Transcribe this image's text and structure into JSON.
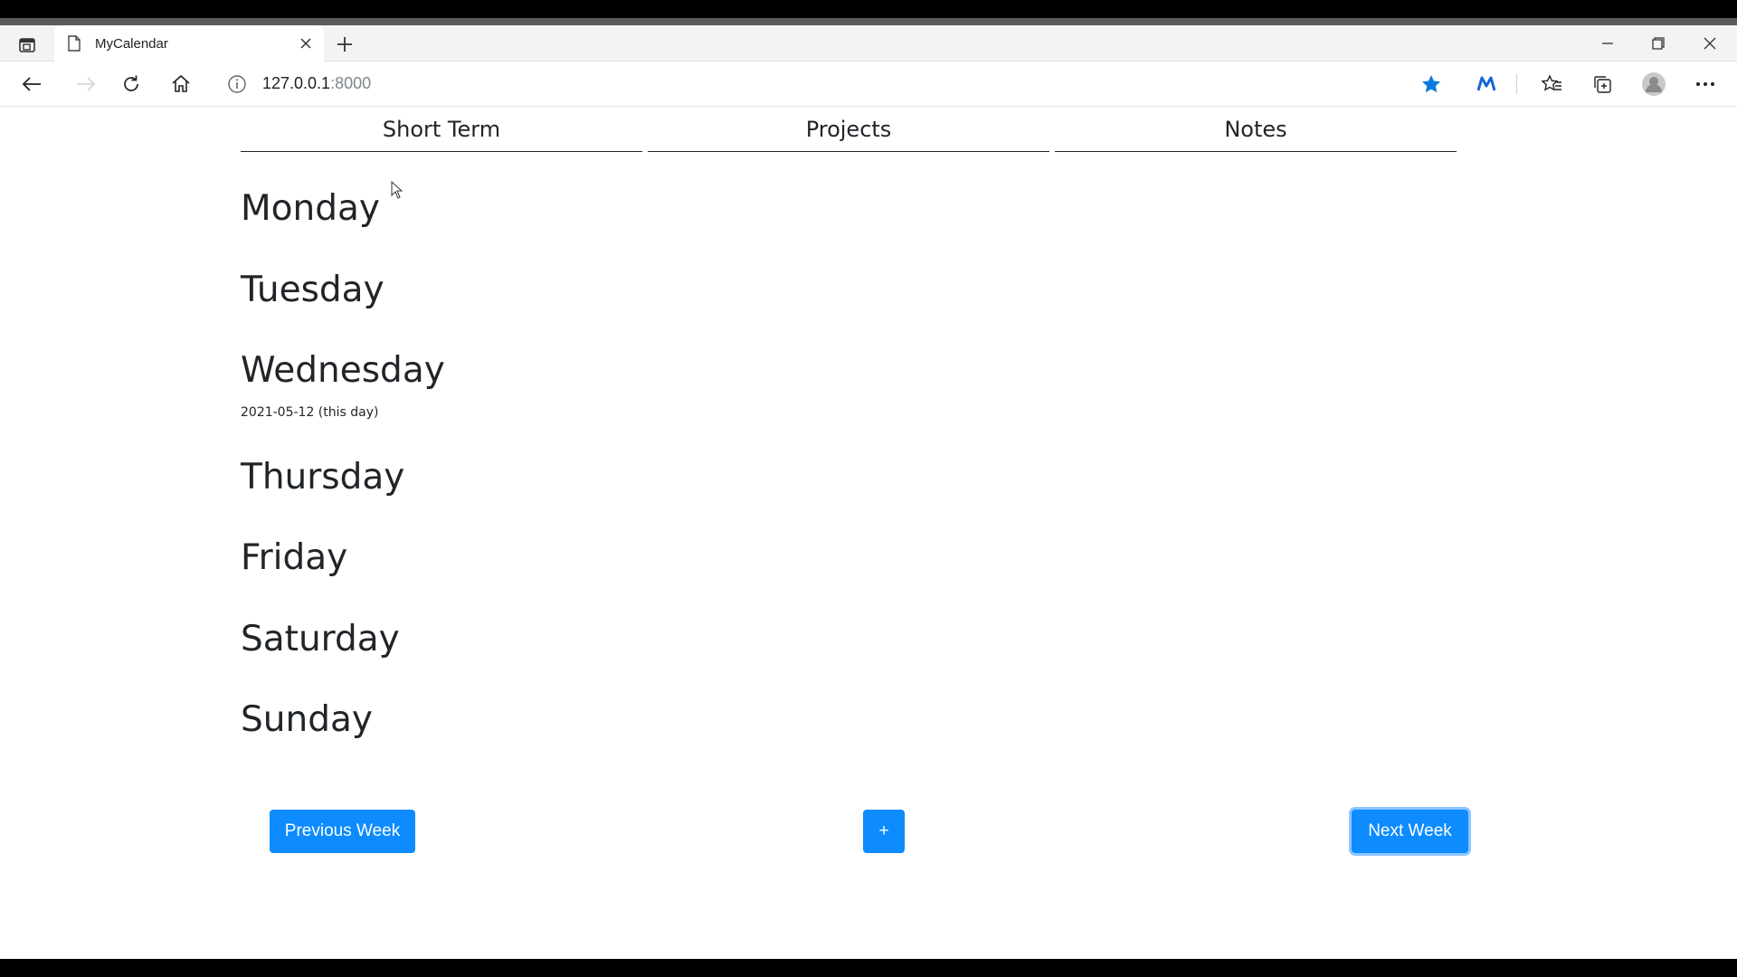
{
  "browser": {
    "tab_title": "MyCalendar",
    "url_host": "127.0.0.1",
    "url_port": ":8000"
  },
  "icons": {
    "tab_actions": "tab-actions-icon",
    "page": "page-icon",
    "close_tab": "close-icon",
    "new_tab": "plus-icon",
    "minimize": "minimize-icon",
    "restore": "restore-icon",
    "close_window": "close-icon",
    "back": "back-arrow-icon",
    "forward": "forward-arrow-icon",
    "reload": "reload-icon",
    "home": "home-icon",
    "site_info": "info-icon",
    "favorite": "star-icon",
    "extension": "m-extension-icon",
    "favorites": "favorites-icon",
    "collections": "collections-icon",
    "profile": "profile-icon",
    "menu": "more-icon"
  },
  "nav": {
    "tabs": [
      "Short Term",
      "Projects",
      "Notes"
    ]
  },
  "week": {
    "days": [
      "Monday",
      "Tuesday",
      "Wednesday",
      "Thursday",
      "Friday",
      "Saturday",
      "Sunday"
    ],
    "today_note": "2021-05-12 (this day)"
  },
  "actions": {
    "previous": "Previous Week",
    "add": "+",
    "next": "Next Week"
  },
  "colors": {
    "accent": "#0d8bff",
    "text": "#212529"
  }
}
